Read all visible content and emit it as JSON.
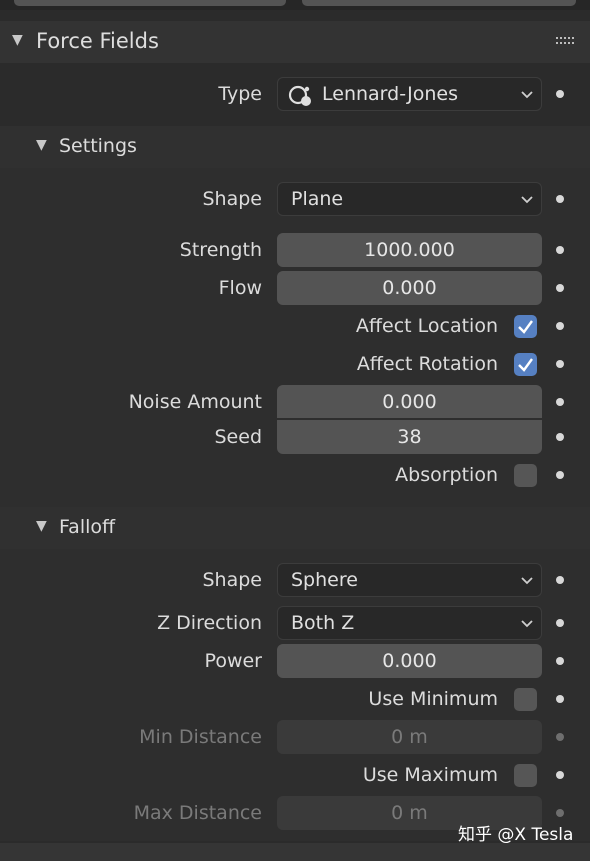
{
  "panel": {
    "title": "Force Fields",
    "type_label": "Type",
    "type_value": "Lennard-Jones"
  },
  "settings": {
    "title": "Settings",
    "shape_label": "Shape",
    "shape_value": "Plane",
    "strength_label": "Strength",
    "strength_value": "1000.000",
    "flow_label": "Flow",
    "flow_value": "0.000",
    "affect_location_label": "Affect Location",
    "affect_location_checked": true,
    "affect_rotation_label": "Affect Rotation",
    "affect_rotation_checked": true,
    "noise_amount_label": "Noise Amount",
    "noise_amount_value": "0.000",
    "seed_label": "Seed",
    "seed_value": "38",
    "absorption_label": "Absorption",
    "absorption_checked": false
  },
  "falloff": {
    "title": "Falloff",
    "shape_label": "Shape",
    "shape_value": "Sphere",
    "z_direction_label": "Z Direction",
    "z_direction_value": "Both Z",
    "power_label": "Power",
    "power_value": "0.000",
    "use_minimum_label": "Use Minimum",
    "use_minimum_checked": false,
    "min_distance_label": "Min Distance",
    "min_distance_value": "0 m",
    "use_maximum_label": "Use Maximum",
    "use_maximum_checked": false,
    "max_distance_label": "Max Distance",
    "max_distance_value": "0 m"
  },
  "watermark": "知乎 @X Tesla",
  "colors": {
    "background": "#2b2b2b",
    "field": "#545454",
    "checkbox_on": "#5680c2",
    "checkbox_off": "#565656"
  }
}
